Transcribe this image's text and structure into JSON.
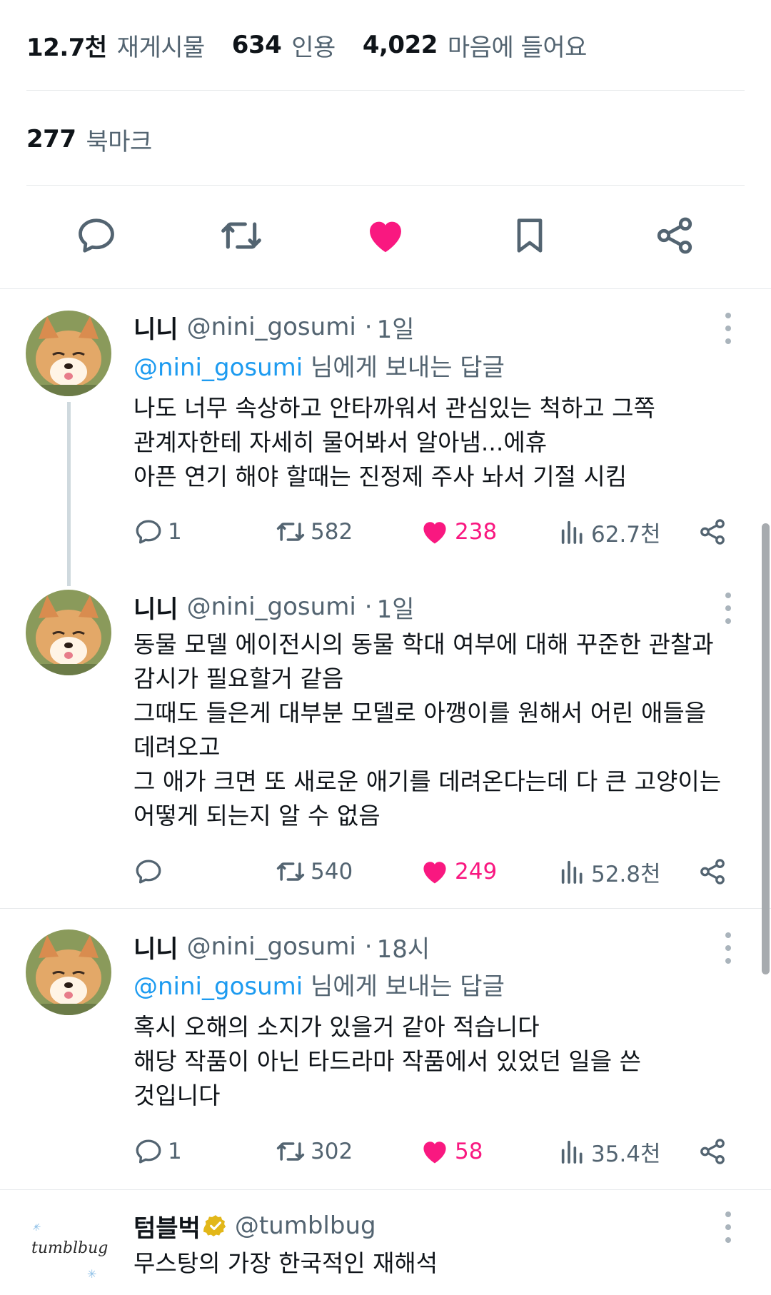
{
  "engagement": {
    "reposts_count": "12.7천",
    "reposts_label": "재게시물",
    "quotes_count": "634",
    "quotes_label": "인용",
    "likes_count": "4,022",
    "likes_label": "마음에 들어요",
    "bookmarks_count": "277",
    "bookmarks_label": "북마크"
  },
  "action_bar": {
    "icons": [
      "reply-icon",
      "repost-icon",
      "like-icon-filled",
      "bookmark-icon",
      "share-icon"
    ],
    "like_color": "#f91880",
    "icon_color": "#536471"
  },
  "tweets": [
    {
      "name": "니니",
      "handle": "@nini_gosumi",
      "time": "1일",
      "reply_mention": "@nini_gosumi",
      "reply_suffix": " 님에게 보내는 답글",
      "lines": [
        "나도 너무 속상하고 안타까워서 관심있는 척하고 그쪽",
        "관계자한테 자세히 물어봐서 알아냄...에휴",
        "아픈 연기 해야 할때는 진정제 주사 놔서 기절 시킴"
      ],
      "replies": "1",
      "reposts": "582",
      "likes": "238",
      "views": "62.7천"
    },
    {
      "name": "니니",
      "handle": "@nini_gosumi",
      "time": "1일",
      "lines": [
        "동물 모델 에이전시의 동물 학대 여부에 대해 꾸준한 관찰과",
        "감시가 필요할거 같음",
        "그때도 들은게 대부분 모델로 아깽이를 원해서 어린 애들을",
        "데려오고",
        "그 애가 크면 또 새로운 애기를 데려온다는데 다 큰 고양이는",
        "어떻게 되는지 알 수 없음"
      ],
      "replies": "",
      "reposts": "540",
      "likes": "249",
      "views": "52.8천"
    },
    {
      "name": "니니",
      "handle": "@nini_gosumi",
      "time": "18시",
      "reply_mention": "@nini_gosumi",
      "reply_suffix": " 님에게 보내는 답글",
      "lines": [
        "혹시 오해의 소지가 있을거 같아 적습니다",
        "해당 작품이 아닌 타드라마 작품에서 있었던 일을 쓴",
        "것입니다"
      ],
      "replies": "1",
      "reposts": "302",
      "likes": "58",
      "views": "35.4천"
    },
    {
      "name": "텀블벅",
      "handle": "@tumblbug",
      "avatar_text": "tumblbug",
      "verified": true,
      "lines": [
        "무스탕의 가장 한국적인 재해석"
      ]
    }
  ]
}
